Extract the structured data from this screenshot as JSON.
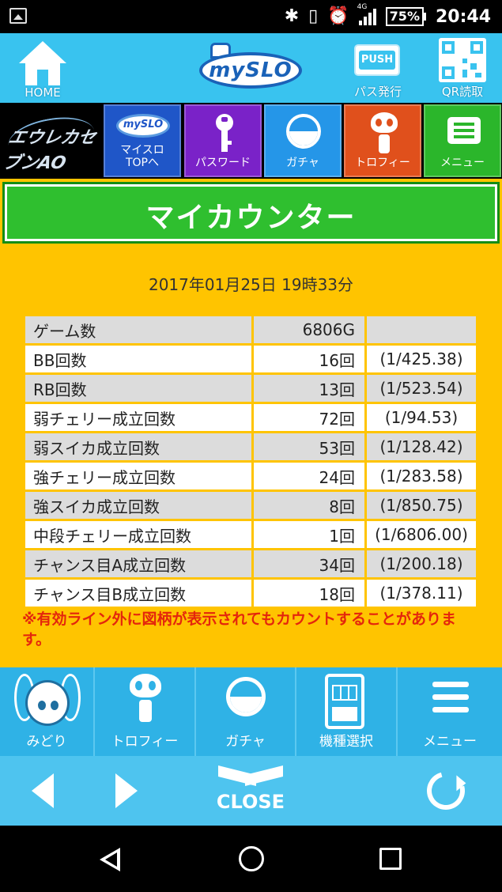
{
  "status_bar": {
    "battery": "75%",
    "network": "4G",
    "time": "20:44",
    "icons": [
      "image-icon",
      "bluetooth-icon",
      "vibrate-icon",
      "alarm-icon",
      "signal-icon",
      "battery-icon"
    ]
  },
  "header": {
    "home_label": "HOME",
    "logo_text": "mySLO",
    "pass_label": "パス発行",
    "push_text": "PUSH",
    "qr_label": "QR読取"
  },
  "nav": {
    "game_logo_text": "エウレカセブンAO",
    "items": [
      {
        "label": "マイスロ\nTOPへ",
        "icon": "myslo-logo-icon",
        "color": "#1f56c8"
      },
      {
        "label": "パスワード",
        "icon": "key-icon",
        "color": "#7a22c8"
      },
      {
        "label": "ガチャ",
        "icon": "gacha-icon",
        "color": "#2596e8"
      },
      {
        "label": "トロフィー",
        "icon": "trophy-robot-icon",
        "color": "#e0501c"
      },
      {
        "label": "メニュー",
        "icon": "menu-icon",
        "color": "#2bb62b"
      }
    ],
    "mini_logo_text": "mySLO"
  },
  "title": "マイカウンター",
  "datetime": "2017年01月25日 19時33分",
  "stats": [
    {
      "name": "ゲーム数",
      "count": "6806G",
      "prob": ""
    },
    {
      "name": "BB回数",
      "count": "16回",
      "prob": "(1/425.38)"
    },
    {
      "name": "RB回数",
      "count": "13回",
      "prob": "(1/523.54)"
    },
    {
      "name": "弱チェリー成立回数",
      "count": "72回",
      "prob": "(1/94.53)"
    },
    {
      "name": "弱スイカ成立回数",
      "count": "53回",
      "prob": "(1/128.42)"
    },
    {
      "name": "強チェリー成立回数",
      "count": "24回",
      "prob": "(1/283.58)"
    },
    {
      "name": "強スイカ成立回数",
      "count": "8回",
      "prob": "(1/850.75)"
    },
    {
      "name": "中段チェリー成立回数",
      "count": "1回",
      "prob": "(1/6806.00)"
    },
    {
      "name": "チャンス目A成立回数",
      "count": "34回",
      "prob": "(1/200.18)"
    },
    {
      "name": "チャンス目B成立回数",
      "count": "18回",
      "prob": "(1/378.11)"
    }
  ],
  "note": "※有効ライン外に図柄が表示されてもカウントすることがあります。",
  "bottom_nav": [
    {
      "label": "みどり",
      "icon": "midori-character-icon"
    },
    {
      "label": "トロフィー",
      "icon": "trophy-robot-icon"
    },
    {
      "label": "ガチャ",
      "icon": "gacha-icon"
    },
    {
      "label": "機種選択",
      "icon": "slot-machine-icon"
    },
    {
      "label": "メニュー",
      "icon": "hamburger-menu-icon"
    }
  ],
  "controls": {
    "close_label": "CLOSE"
  },
  "colors": {
    "header_bg": "#39c3ef",
    "counter_bg": "#ffc400",
    "title_green": "#2fbf2f",
    "note_red": "#e4260c",
    "bottom_nav_bg": "#2fb2e6"
  }
}
